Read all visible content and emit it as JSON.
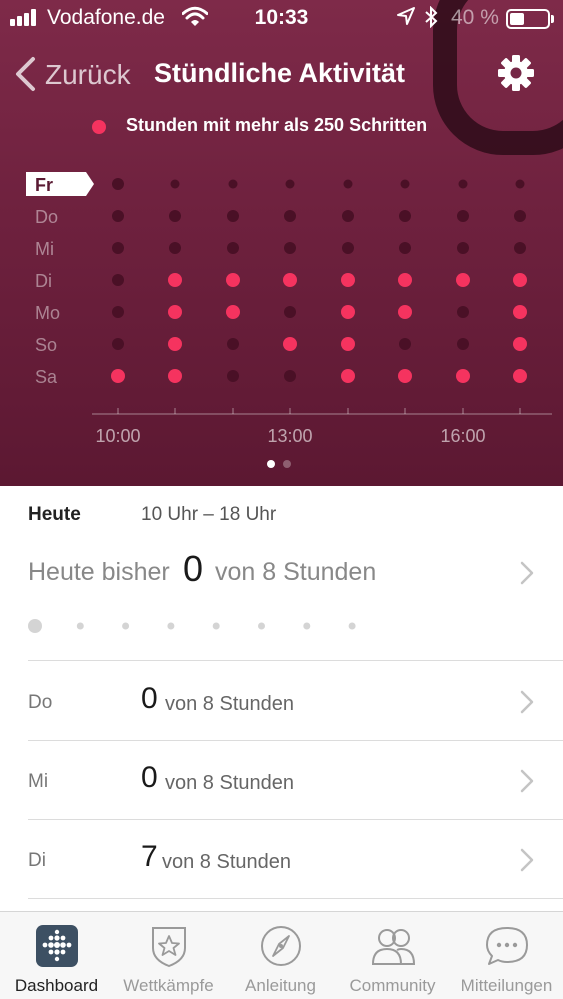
{
  "status_bar": {
    "carrier": "Vodafone.de",
    "time": "10:33",
    "battery_percent": "40 %",
    "battery_level": 0.4,
    "icons": [
      "signal-icon",
      "wifi-icon",
      "location-icon",
      "bluetooth-icon",
      "battery-icon"
    ]
  },
  "nav": {
    "back_label": "Zurück",
    "title": "Stündliche Aktivität",
    "settings_icon": "gear-icon"
  },
  "legend": {
    "label": "Stunden mit mehr als 250 Schritten",
    "color": "#f5335f"
  },
  "activity_grid": {
    "selected_day": "Fr",
    "active_color": "#f5335f",
    "inactive_color": "#4a1026",
    "x_ticks": [
      "10:00",
      "13:00",
      "16:00"
    ],
    "rows": [
      {
        "day": "Fr",
        "hours": [
          0,
          0,
          0,
          0,
          0,
          0,
          0,
          0
        ]
      },
      {
        "day": "Do",
        "hours": [
          0,
          0,
          0,
          0,
          0,
          0,
          0,
          0
        ]
      },
      {
        "day": "Mi",
        "hours": [
          0,
          0,
          0,
          0,
          0,
          0,
          0,
          0
        ]
      },
      {
        "day": "Di",
        "hours": [
          0,
          1,
          1,
          1,
          1,
          1,
          1,
          1
        ]
      },
      {
        "day": "Mo",
        "hours": [
          0,
          1,
          1,
          0,
          1,
          1,
          0,
          1
        ]
      },
      {
        "day": "So",
        "hours": [
          0,
          1,
          0,
          1,
          1,
          0,
          0,
          1
        ]
      },
      {
        "day": "Sa",
        "hours": [
          1,
          1,
          0,
          0,
          1,
          1,
          1,
          1
        ]
      }
    ],
    "pager": {
      "count": 2,
      "active": 0
    }
  },
  "today": {
    "label": "Heute",
    "range": "10 Uhr – 18 Uhr",
    "summary_label": "Heute bisher",
    "count": "0",
    "suffix": "von 8 Stunden",
    "hour_dots": 8
  },
  "days": [
    {
      "day": "Do",
      "count": "0",
      "suffix": "von 8 Stunden"
    },
    {
      "day": "Mi",
      "count": "0",
      "suffix": "von 8 Stunden"
    },
    {
      "day": "Di",
      "count": "7",
      "suffix": "von 8 Stunden"
    }
  ],
  "tabs": [
    {
      "label": "Dashboard",
      "icon": "dashboard-icon",
      "active": true
    },
    {
      "label": "Wettkämpfe",
      "icon": "challenge-badge-icon",
      "active": false
    },
    {
      "label": "Anleitung",
      "icon": "compass-icon",
      "active": false
    },
    {
      "label": "Community",
      "icon": "community-icon",
      "active": false
    },
    {
      "label": "Mitteilungen",
      "icon": "chat-bubble-icon",
      "active": false
    }
  ]
}
